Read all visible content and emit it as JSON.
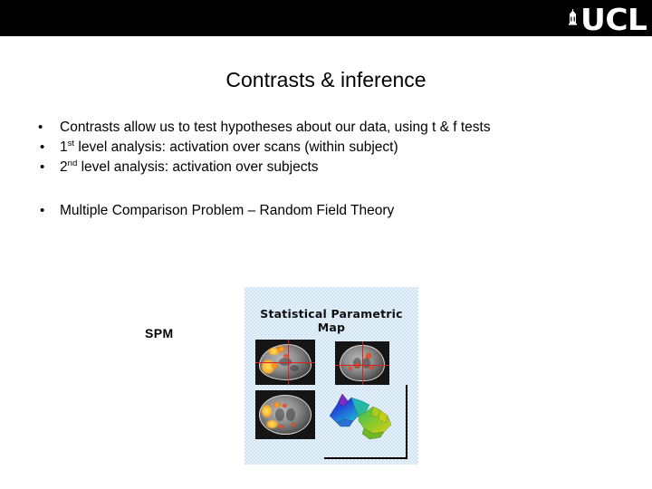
{
  "banner": {
    "logo_mark": "ucl-building-icon",
    "wordmark": "UCL"
  },
  "slide": {
    "title": "Contrasts & inference",
    "bullet_marker": "•",
    "bullets": [
      {
        "id": "contrasts",
        "text_before": "Contrasts allow us to test hypotheses about our data, using t & f tests",
        "sup": "",
        "text_after": "",
        "gap_before": false,
        "indent": false
      },
      {
        "id": "first-level",
        "text_before": "1",
        "sup": "st",
        "text_after": " level analysis: activation over scans (within subject)",
        "gap_before": false,
        "indent": true
      },
      {
        "id": "second-level",
        "text_before": "2",
        "sup": "nd",
        "text_after": " level analysis: activation over subjects",
        "gap_before": false,
        "indent": true
      },
      {
        "id": "multiple-comparison",
        "text_before": "Multiple Comparison Problem – Random Field Theory",
        "sup": "",
        "text_after": "",
        "gap_before": true,
        "indent": true
      }
    ],
    "spm_label": "SPM"
  },
  "figure": {
    "name": "statistical-parametric-map",
    "title": "Statistical Parametric Map",
    "background_color": "#e8f2fb",
    "panels": [
      {
        "id": "sagittal",
        "label": "sagittal-brain-slice",
        "has_crosshair": true
      },
      {
        "id": "coronal",
        "label": "coronal-brain-slice",
        "has_crosshair": true
      },
      {
        "id": "axial",
        "label": "axial-brain-slice",
        "has_crosshair": false
      },
      {
        "id": "surface",
        "label": "3d-surface-plot",
        "has_crosshair": false
      }
    ],
    "activation_colors": {
      "hot_high": "#ffe66a",
      "hot_mid": "#ef7a12",
      "hot_low": "#e03510",
      "crosshair": "#e02020"
    },
    "surface_colormap": [
      "#2030c0",
      "#1aa0d0",
      "#30c060",
      "#9fd020",
      "#e0d020"
    ]
  }
}
